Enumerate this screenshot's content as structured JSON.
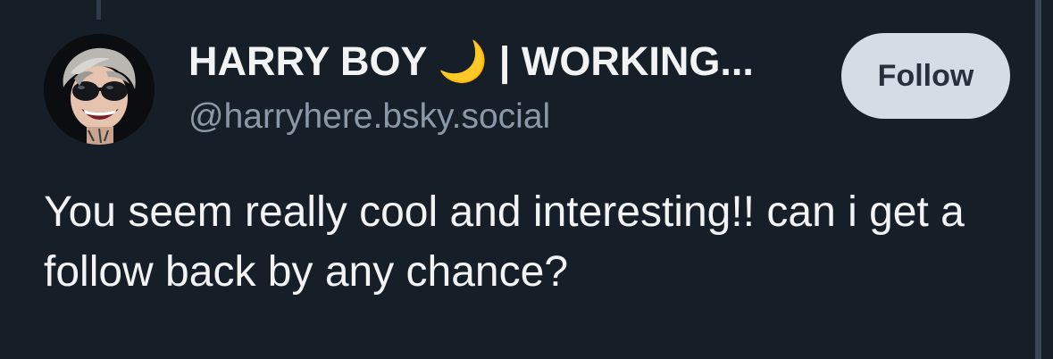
{
  "profile": {
    "display_name": "HARRY BOY 🌙 | WORKING...",
    "handle": "@harryhere.bsky.social",
    "avatar_icon": "avatar-image"
  },
  "actions": {
    "follow_label": "Follow"
  },
  "post": {
    "text": "You seem really cool and interesting!! can i get a follow back by any chance?"
  },
  "colors": {
    "background": "#161e27",
    "text_primary": "#f1f3f5",
    "text_secondary": "#8b98a8",
    "follow_button_bg": "#d4dce5",
    "follow_button_text": "#27313d"
  }
}
